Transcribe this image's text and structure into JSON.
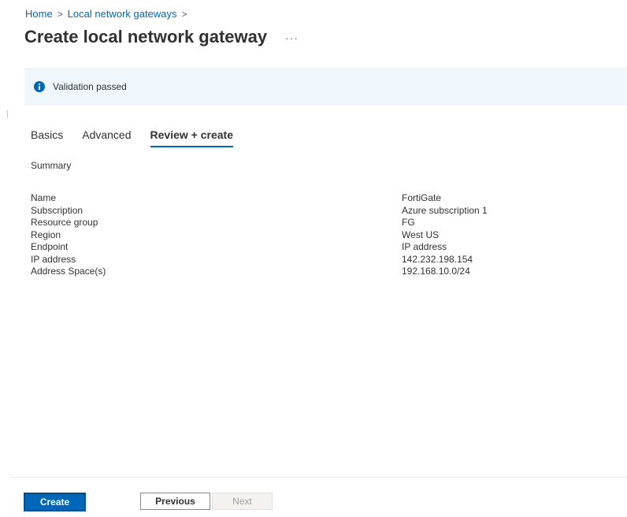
{
  "breadcrumb": {
    "items": [
      "Home",
      "Local network gateways"
    ],
    "separator": ">"
  },
  "page": {
    "title": "Create local network gateway",
    "more_label": "···"
  },
  "banner": {
    "text": "Validation passed",
    "icon": "info-icon",
    "icon_color": "#0067b8"
  },
  "tabs": [
    {
      "label": "Basics",
      "active": false
    },
    {
      "label": "Advanced",
      "active": false
    },
    {
      "label": "Review + create",
      "active": true
    }
  ],
  "summary": {
    "title": "Summary",
    "rows": [
      {
        "key": "Name",
        "value": "FortiGate"
      },
      {
        "key": "Subscription",
        "value": "Azure subscription 1"
      },
      {
        "key": "Resource group",
        "value": "FG"
      },
      {
        "key": "Region",
        "value": "West US"
      },
      {
        "key": "Endpoint",
        "value": "IP address"
      },
      {
        "key": "IP address",
        "value": "142.232.198.154"
      },
      {
        "key": "Address Space(s)",
        "value": "192.168.10.0/24"
      }
    ]
  },
  "footer": {
    "create_label": "Create",
    "previous_label": "Previous",
    "next_label": "Next",
    "next_disabled": true
  },
  "colors": {
    "accent": "#0067b8",
    "banner_bg": "#eff6fc"
  }
}
